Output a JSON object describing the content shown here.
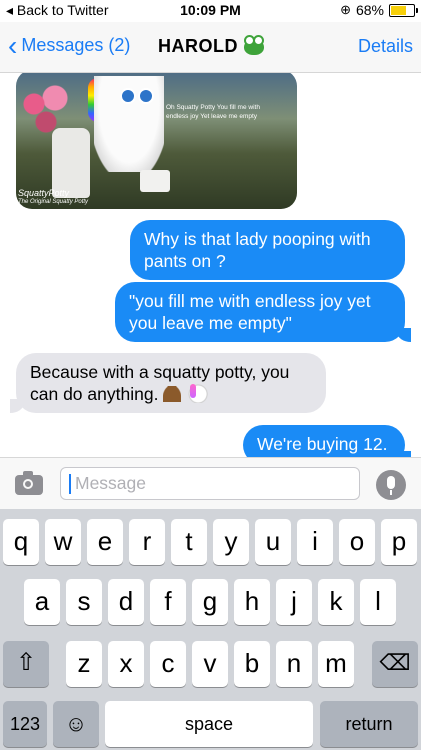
{
  "status": {
    "back_label": "Back to Twitter",
    "time": "10:09 PM",
    "battery": "68%",
    "battery_level": 0.68
  },
  "nav": {
    "back_label": "Messages (2)",
    "title": "HAROLD",
    "details_label": "Details"
  },
  "photo": {
    "caption": "Oh Squatty Potty You fill me with endless joy Yet leave me empty",
    "brand": "SquattyPotty",
    "brand_sub": "The Original Squatty Potty"
  },
  "messages": [
    {
      "direction": "out",
      "text": "Why is that lady pooping with pants on ?"
    },
    {
      "direction": "out",
      "text": "\"you fill me with endless joy yet you leave me empty\""
    },
    {
      "direction": "in",
      "text": "Because with a squatty potty, you can do anything."
    },
    {
      "direction": "out",
      "text": "We're buying 12."
    }
  ],
  "input": {
    "placeholder": "Message"
  },
  "keyboard": {
    "row1": [
      "q",
      "w",
      "e",
      "r",
      "t",
      "y",
      "u",
      "i",
      "o",
      "p"
    ],
    "row2": [
      "a",
      "s",
      "d",
      "f",
      "g",
      "h",
      "j",
      "k",
      "l"
    ],
    "row3": [
      "z",
      "x",
      "c",
      "v",
      "b",
      "n",
      "m"
    ],
    "numbers_label": "123",
    "space_label": "space",
    "return_label": "return"
  }
}
